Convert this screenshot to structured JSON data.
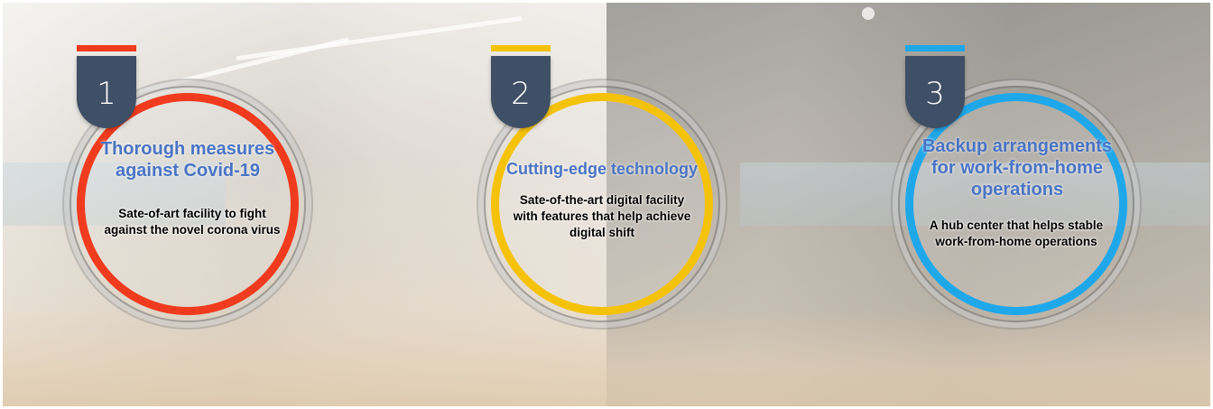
{
  "colors": {
    "badge": "#3f4f65",
    "title": "#4a74c4",
    "ring_1": "#f03b1e",
    "ring_2": "#f5c20a",
    "ring_3": "#1ea8ea"
  },
  "items": [
    {
      "number": "1",
      "title_line1": "Thorough measures",
      "title_line2": "against Covid-19",
      "desc_line1": "Sate-of-art facility to fight",
      "desc_line2": "against the novel corona virus",
      "accent_color": "#f03b1e"
    },
    {
      "number": "2",
      "title_line1": "Cutting-edge technology",
      "desc_line1": "Sate-of-the-art digital facility",
      "desc_line2": "with features that help achieve",
      "desc_line3": "digital shift",
      "accent_color": "#f5c20a"
    },
    {
      "number": "3",
      "title_line1": "Backup arrangements",
      "title_line2": "for work-from-home",
      "title_line3": "operations",
      "desc_line1": "A hub center that helps stable",
      "desc_line2": "work-from-home operations",
      "accent_color": "#1ea8ea"
    }
  ]
}
